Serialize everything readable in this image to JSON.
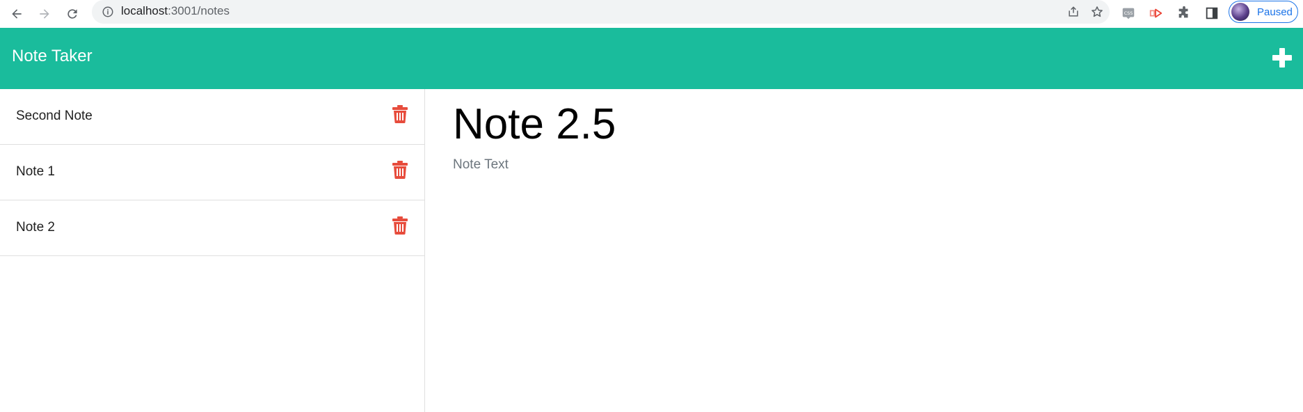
{
  "browser": {
    "url_host": "localhost",
    "url_rest": ":3001/notes",
    "profile_label": "Paused",
    "accent_color": "#1a73e8"
  },
  "app": {
    "title": "Note Taker",
    "header_color": "#1abc9c",
    "add_icon": "plus-icon"
  },
  "notes": [
    {
      "title": "Second Note"
    },
    {
      "title": "Note 1"
    },
    {
      "title": "Note 2"
    }
  ],
  "editor": {
    "title_value": "Note 2.5",
    "text_value": "",
    "text_placeholder": "Note Text"
  },
  "trash_color": "#e74c3c"
}
